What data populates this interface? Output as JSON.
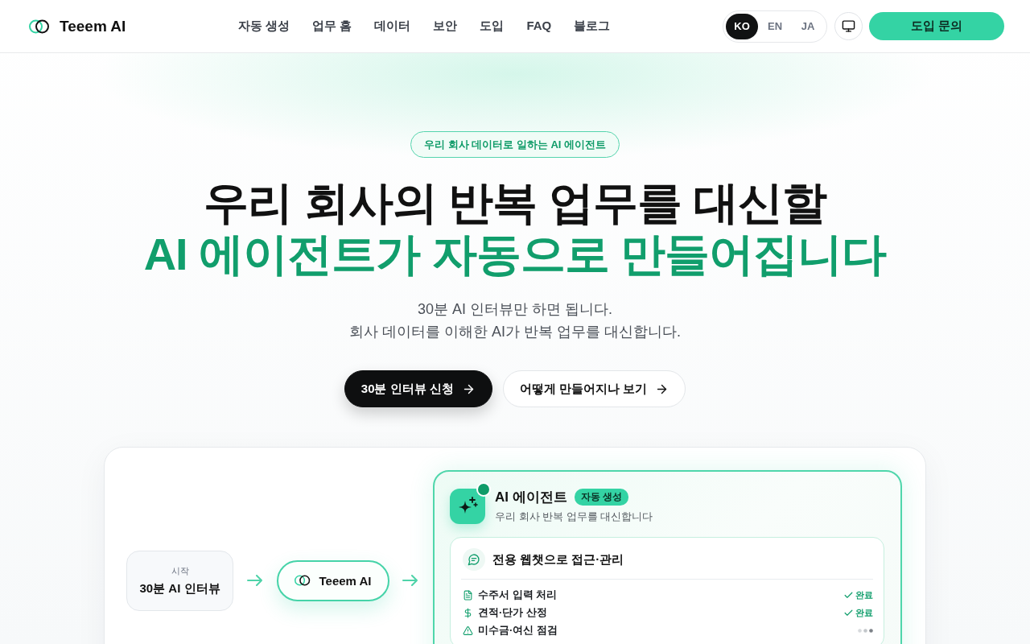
{
  "header": {
    "logo": "Teeem AI",
    "nav": [
      {
        "label": "자동 생성"
      },
      {
        "label": "업무 홈"
      },
      {
        "label": "데이터"
      },
      {
        "label": "보안"
      },
      {
        "label": "도입"
      },
      {
        "label": "FAQ"
      },
      {
        "label": "블로그"
      }
    ],
    "languages": [
      {
        "label": "KO",
        "selected": true
      },
      {
        "label": "EN",
        "selected": false
      },
      {
        "label": "JA",
        "selected": false
      }
    ],
    "cta": "도입 문의"
  },
  "hero": {
    "badge": "우리 회사 데이터로 일하는 AI 에이전트",
    "title": "우리 회사의 반복 업무를 대신할",
    "title_highlight": "AI 에이전트가 자동으로 만들어집니다",
    "subtitle_lines": [
      "30분 AI 인터뷰만 하면 됩니다.",
      "회사 데이터를 이해한 AI가 반복 업무를 대신합니다."
    ],
    "buttons": [
      {
        "label": "30분 인터뷰 신청",
        "kind": "primary"
      },
      {
        "label": "어떻게 만들어지나 보기",
        "kind": "secondary"
      }
    ]
  },
  "flow": {
    "start": {
      "caption": "시작",
      "title": "30분 AI 인터뷰"
    },
    "engine": {
      "label": "Teeem AI"
    },
    "agent": {
      "title": "AI 에이전트",
      "badge": "자동 생성",
      "subtitle": "우리 회사 반복 업무를 대신합니다",
      "channel": {
        "title": "전용 웹챗으로 접근·관리"
      },
      "tasks": [
        {
          "kind": "document",
          "label": "수주서 입력 처리",
          "done": true,
          "status": "완료"
        },
        {
          "kind": "money",
          "label": "견적·단가 산정",
          "done": true,
          "status": "완료"
        },
        {
          "kind": "warning",
          "label": "미수금·여신 점검",
          "done": false
        }
      ]
    }
  }
}
